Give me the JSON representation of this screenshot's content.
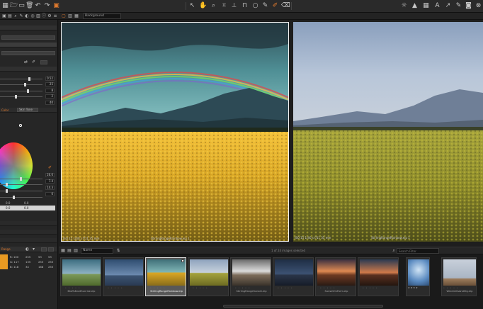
{
  "toolbar": {
    "left_icons": [
      "grid-icon",
      "folder-open-icon",
      "folder-icon",
      "trash-icon",
      "undo-icon",
      "redo-icon",
      "reset-icon"
    ],
    "center_icons": [
      "pointer-icon",
      "pan-icon",
      "zoom-icon",
      "crop-icon",
      "straighten-icon",
      "keystone-icon",
      "spot-removal-icon",
      "local-adjust-icon",
      "picker-icon",
      "brush-icon",
      "eraser-icon"
    ],
    "right_icons": [
      "lightbulb-icon",
      "warning-icon",
      "grid-overlay-icon",
      "text-icon",
      "cursor-icon",
      "brush-tool-icon",
      "camera-icon",
      "close-icon"
    ],
    "accent_color": "#e07a2e"
  },
  "subbar": {
    "view_select": "Background"
  },
  "left_panel": {
    "numbers_top": [
      "0.52",
      "25",
      "8",
      "2",
      "40"
    ],
    "tab_left": "Color",
    "tab_right": "Skin Tone",
    "numbers_mid": [
      "26.0",
      "7.4",
      "14.3",
      "0"
    ],
    "values_lower": [
      "0.0",
      "0.0"
    ],
    "section_label": "Range",
    "readout": {
      "r": "R: 100",
      "r2": "255",
      "r3": "53",
      "r4": "53",
      "g": "G: 117",
      "g2": "135",
      "g3": "255",
      "g4": "255",
      "b": "B: 118",
      "b2": "34",
      "b3": "168",
      "b4": "255"
    },
    "swatch_color": "#e89a22"
  },
  "viewer": {
    "left_info": "ISO 15    1/40 s    f/11    35 mm",
    "left_name": "StirlingRangeRainbow.eip 1",
    "right_info": "ISO 15    1/40 s    f/11    35 mm",
    "right_name": "StirlingRangeRainbow.eip 1"
  },
  "browser": {
    "sort_select": "Name",
    "status": "1 of 24 images selected",
    "search_placeholder": "Search Filter",
    "thumbs": [
      {
        "name": "BluffsKnollSunrise.eip",
        "selected": false
      },
      {
        "name": "",
        "selected": false
      },
      {
        "name": "StirlingRangeRainbow.eip",
        "selected": true
      },
      {
        "name": "",
        "selected": false
      },
      {
        "name": "StirlingRangeSunset.eip",
        "selected": false
      },
      {
        "name": "",
        "selected": false
      },
      {
        "name": "SunsetOnFarm.eip",
        "selected": false
      },
      {
        "name": "",
        "selected": false
      },
      {
        "name": "",
        "selected": false
      },
      {
        "name": "WindmillsAndSky.eip",
        "selected": false
      }
    ]
  }
}
